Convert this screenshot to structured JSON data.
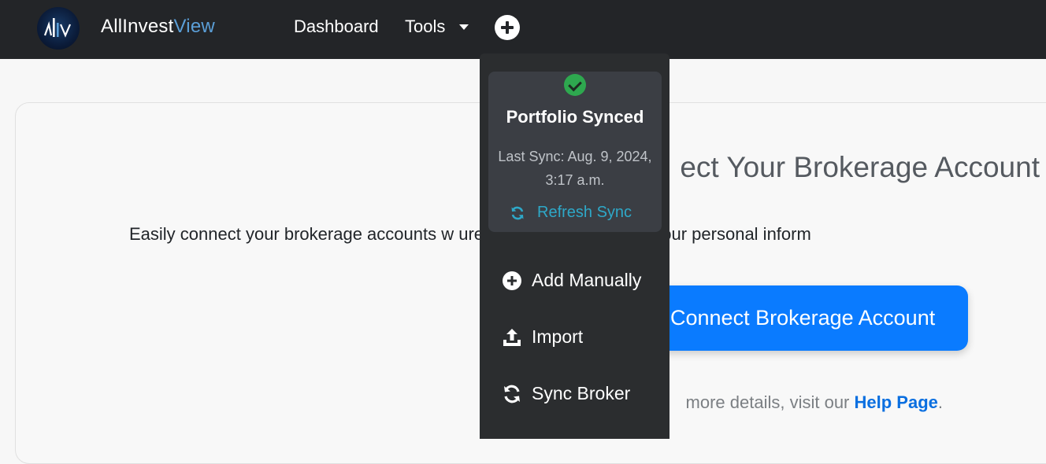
{
  "navbar": {
    "brand_main": "AllInvest",
    "brand_accent": "View",
    "links": [
      {
        "label": "Dashboard"
      },
      {
        "label": "Tools"
      }
    ],
    "add_icon": "plus-circle-icon"
  },
  "main": {
    "title": "ect Your Brokerage Account",
    "description": "Easily connect your brokerage accounts w                                     ure cloud-based service. Your personal inform",
    "connect_button": "Connect Brokerage Account",
    "help_prefix": "more details, visit our ",
    "help_link": "Help Page",
    "help_suffix": "."
  },
  "dropdown": {
    "status_icon": "check-circle-icon",
    "status_title": "Portfolio Synced",
    "last_sync_line1": "Last Sync: Aug. 9, 2024,",
    "last_sync_line2": "3:17 a.m.",
    "refresh_label": "Refresh Sync",
    "items": [
      {
        "label": "Add Manually",
        "icon": "plus-circle-icon"
      },
      {
        "label": "Import",
        "icon": "upload-icon"
      },
      {
        "label": "Sync Broker",
        "icon": "sync-icon"
      }
    ]
  },
  "colors": {
    "navbar": "#232528",
    "accent": "#0a7bff",
    "success": "#2ea84f",
    "refresh": "#2ea8c8"
  }
}
